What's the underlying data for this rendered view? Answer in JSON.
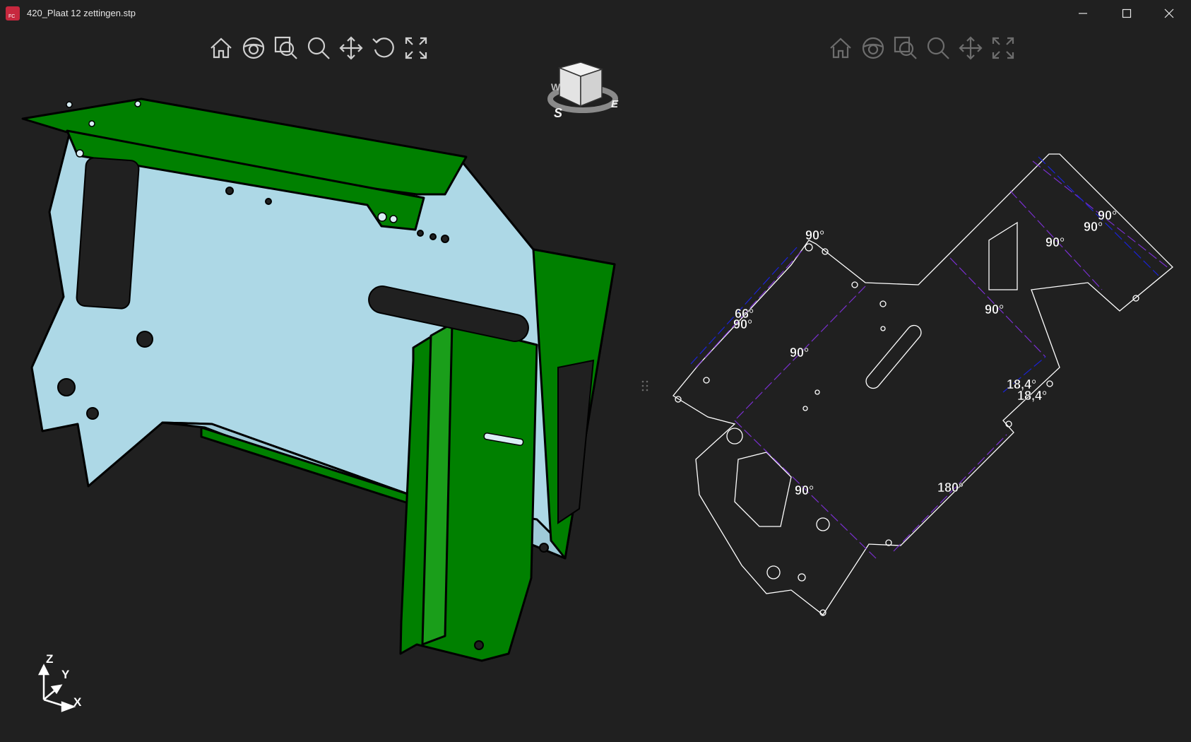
{
  "window": {
    "title": "420_Plaat 12 zettingen.stp",
    "app_icon_text": "FC",
    "controls": {
      "minimize": "minimize-icon",
      "maximize": "maximize-icon",
      "close": "close-icon"
    }
  },
  "toolbar_left": {
    "buttons": [
      "home-icon",
      "orbit-icon",
      "zoom-fit-icon",
      "zoom-icon",
      "pan-icon",
      "rotate-icon",
      "expand-icon"
    ]
  },
  "toolbar_right": {
    "buttons": [
      "home-icon",
      "orbit-icon",
      "zoom-fit-icon",
      "zoom-icon",
      "pan-icon",
      "expand-icon"
    ],
    "state": "disabled"
  },
  "viewcube": {
    "compass": {
      "west": "W",
      "south": "S",
      "east": "E"
    }
  },
  "axis": {
    "z": "Z",
    "y": "Y",
    "x": "X"
  },
  "unfolded": {
    "bend_labels": [
      "90°",
      "90°",
      "90°",
      "90°",
      "66°",
      "90°",
      "90°",
      "90°",
      "18,4°",
      "18,4°",
      "90°",
      "180°"
    ]
  },
  "colors": {
    "background": "#202020",
    "part_face": "#add8e6",
    "bend_face": "#008000",
    "bend_line_blue": "#1a22d6",
    "bend_line_purple": "#7a2fd0",
    "outline": "#ffffff"
  }
}
